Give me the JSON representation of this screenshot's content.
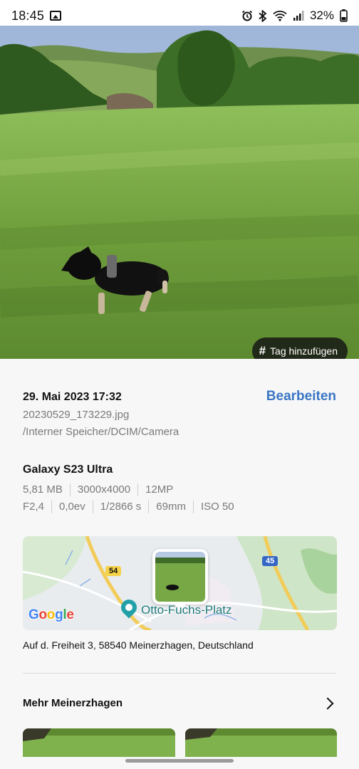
{
  "status_bar": {
    "time": "18:45",
    "notification_icons": [
      "gallery-icon"
    ],
    "system_icons": [
      "alarm-icon",
      "bluetooth-icon",
      "wifi-icon",
      "signal-icon"
    ],
    "battery": "32%"
  },
  "photo": {
    "tag_button_label": "Tag hinzufügen",
    "tag_icon": "hash-icon"
  },
  "details": {
    "date": "29. Mai 2023 17:32",
    "edit_label": "Bearbeiten",
    "filename": "20230529_173229.jpg",
    "path": "/Interner Speicher/DCIM/Camera",
    "device": "Galaxy S23 Ultra",
    "file_info": [
      "5,81 MB",
      "3000x4000",
      "12MP"
    ],
    "camera_info": [
      "F2,4",
      "0,0ev",
      "1/2866 s",
      "69mm",
      "ISO 50"
    ]
  },
  "map": {
    "logo": "Google",
    "place_label": "Otto-Fuchs-Platz",
    "road_labels": [
      "54",
      "45"
    ],
    "address": "Auf d. Freiheit 3, 58540 Meinerzhagen, Deutschland"
  },
  "more": {
    "title": "Mehr Meinerzhagen",
    "icon": "chevron-right-icon"
  },
  "colors": {
    "accent": "#3a76c4",
    "background": "#f7f7f7"
  }
}
